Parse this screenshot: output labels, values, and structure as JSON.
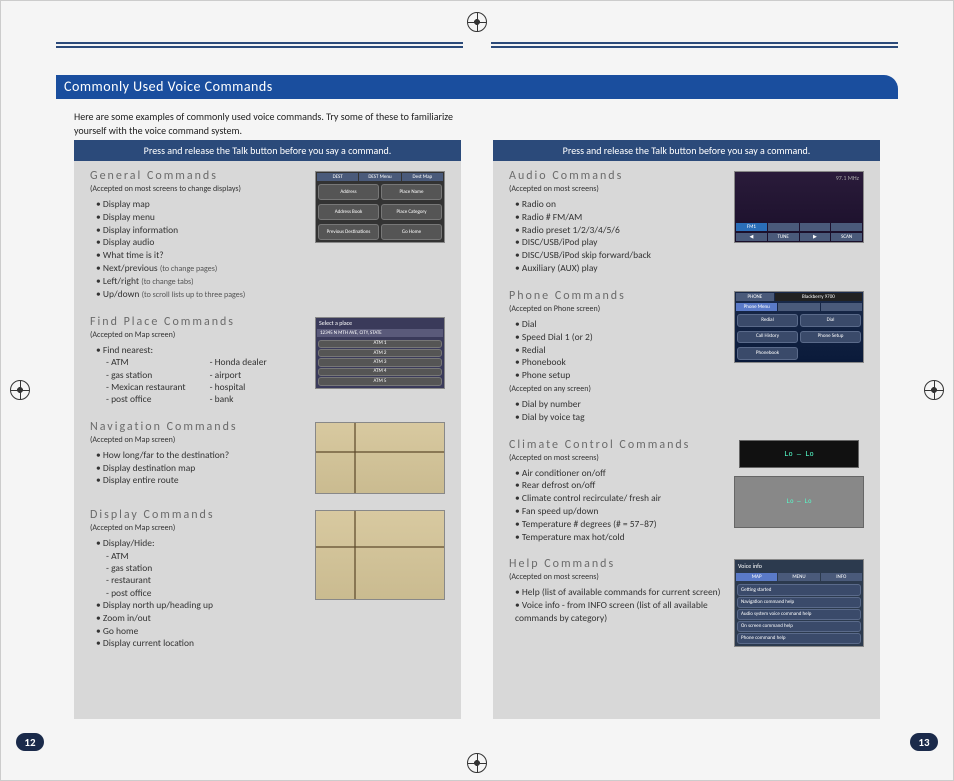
{
  "tab_title": "Commonly Used Voice Commands",
  "intro": "Here are some examples of commonly used voice commands.  Try some of these to familiarize yourself with the voice command system.",
  "talk_instruction": "Press and release the Talk button before you say a command.",
  "page_left": "12",
  "page_right": "13",
  "left": {
    "general": {
      "title": "General Commands",
      "sub": "(Accepted on most screens to change displays)",
      "items": [
        "Display map",
        "Display menu",
        "Display information",
        "Display audio",
        "What time is it?",
        "Next/previous",
        "Left/right",
        "Up/down"
      ],
      "notes": {
        "5": "(to change pages)",
        "6": "(to change tabs)",
        "7": "(to scroll lists up to three pages)"
      },
      "thumb": {
        "hdr": [
          "DEST",
          "DEST Menu",
          "Dest Map"
        ],
        "r1": [
          "Address",
          "Place Name"
        ],
        "r2": [
          "Address Book",
          "Place Category"
        ],
        "r3": [
          "Previous Destinations",
          "Go Home"
        ]
      }
    },
    "find": {
      "title": "Find Place Commands",
      "sub": "(Accepted on Map screen)",
      "lead": "Find nearest:",
      "colA": [
        "ATM",
        "gas station",
        "Mexican restaurant",
        "post office"
      ],
      "colB": [
        "Honda dealer",
        "airport",
        "hospital",
        "bank"
      ],
      "thumb": {
        "sel": "Select a place",
        "addr": "12345 N MTH AVE, CITY, STATE",
        "rows": [
          "ATM 1",
          "ATM 2",
          "ATM 3",
          "ATM 4",
          "ATM 5"
        ]
      }
    },
    "nav": {
      "title": "Navigation Commands",
      "sub": "(Accepted on Map screen)",
      "items": [
        "How long/far to the destination?",
        "Display destination map",
        "Display entire route"
      ]
    },
    "display": {
      "title": "Display Commands",
      "sub": "(Accepted on Map screen)",
      "lead": "Display/Hide:",
      "subs": [
        "ATM",
        "gas station",
        "restaurant",
        "post office"
      ],
      "items": [
        "Display north up/heading up",
        "Zoom in/out",
        "Go home",
        "Display current location"
      ]
    }
  },
  "right": {
    "audio": {
      "title": "Audio Commands",
      "sub": "(Accepted on most screens)",
      "items": [
        "Radio on",
        "Radio # FM/AM",
        "Radio preset 1/2/3/4/5/6",
        "DISC/USB/iPod play",
        "DISC/USB/iPod skip forward/back",
        "Auxiliary (AUX) play"
      ],
      "thumb": {
        "freq": "97.1 MHz",
        "band": "FM1",
        "ctrls": [
          "◀",
          "TUNE",
          "▶",
          "SCAN"
        ]
      }
    },
    "phone": {
      "title": "Phone Commands",
      "sub": "(Accepted on Phone screen)",
      "items": [
        "Dial",
        "Speed Dial 1 (or 2)",
        "Redial",
        "Phonebook",
        "Phone setup"
      ],
      "sub2": "(Accepted on any screen)",
      "items2": [
        "Dial by number",
        "Dial by voice tag"
      ],
      "thumb": {
        "hdr": "PHONE",
        "dev": "Blackberry 9700",
        "tab": "Phone Menu",
        "r1": [
          "Redial",
          "Dial"
        ],
        "r2": [
          "Call History",
          "Phone Setup"
        ],
        "r3": [
          "Phonebook",
          ""
        ]
      }
    },
    "climate": {
      "title": "Climate Control Commands",
      "sub": "(Accepted on most screens)",
      "items": [
        "Air conditioner on/off",
        "Rear defrost on/off",
        "Climate control recirculate/ fresh air",
        "Fan speed up/down",
        "Temperature # degrees (# = 57–87)",
        "Temperature max hot/cold"
      ],
      "disp": "Lo  —  Lo"
    },
    "help": {
      "title": "Help Commands",
      "sub": "(Accepted on most screens)",
      "items": [
        "Help (list of available commands for current screen)",
        "Voice info - from INFO screen (list of all available commands by category)"
      ],
      "thumb": {
        "hdr": "Voice info",
        "tabs": [
          "MAP",
          "MENU",
          "INFO"
        ],
        "rows": [
          "Getting started",
          "Navigation command help",
          "Audio system voice command help",
          "On screen command help",
          "Phone command help"
        ]
      }
    }
  }
}
